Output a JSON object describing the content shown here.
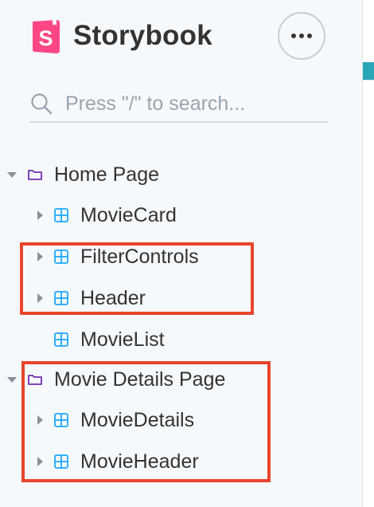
{
  "brand": {
    "title": "Storybook"
  },
  "search": {
    "placeholder": "Press \"/\" to search..."
  },
  "tree": {
    "home_page": {
      "label": "Home Page",
      "children": {
        "movie_card": "MovieCard",
        "filter_controls": "FilterControls",
        "header": "Header",
        "movie_list": "MovieList"
      }
    },
    "movie_details_page": {
      "label": "Movie Details Page",
      "children": {
        "movie_details": "MovieDetails",
        "movie_header": "MovieHeader"
      }
    }
  },
  "colors": {
    "sidebar_bg": "#f6f9fc",
    "logo_pink": "#ff4785",
    "folder_purple": "#6f2cac",
    "component_blue": "#1ea7fd",
    "annotation_red": "#e8452c",
    "text_dark": "#333333"
  },
  "icons": {
    "logo": "storybook-logo-icon",
    "menu": "more-dots-icon",
    "search": "search-icon",
    "folder": "folder-icon",
    "component": "component-icon",
    "caret_down": "caret-down-icon",
    "caret_right": "caret-right-icon"
  }
}
